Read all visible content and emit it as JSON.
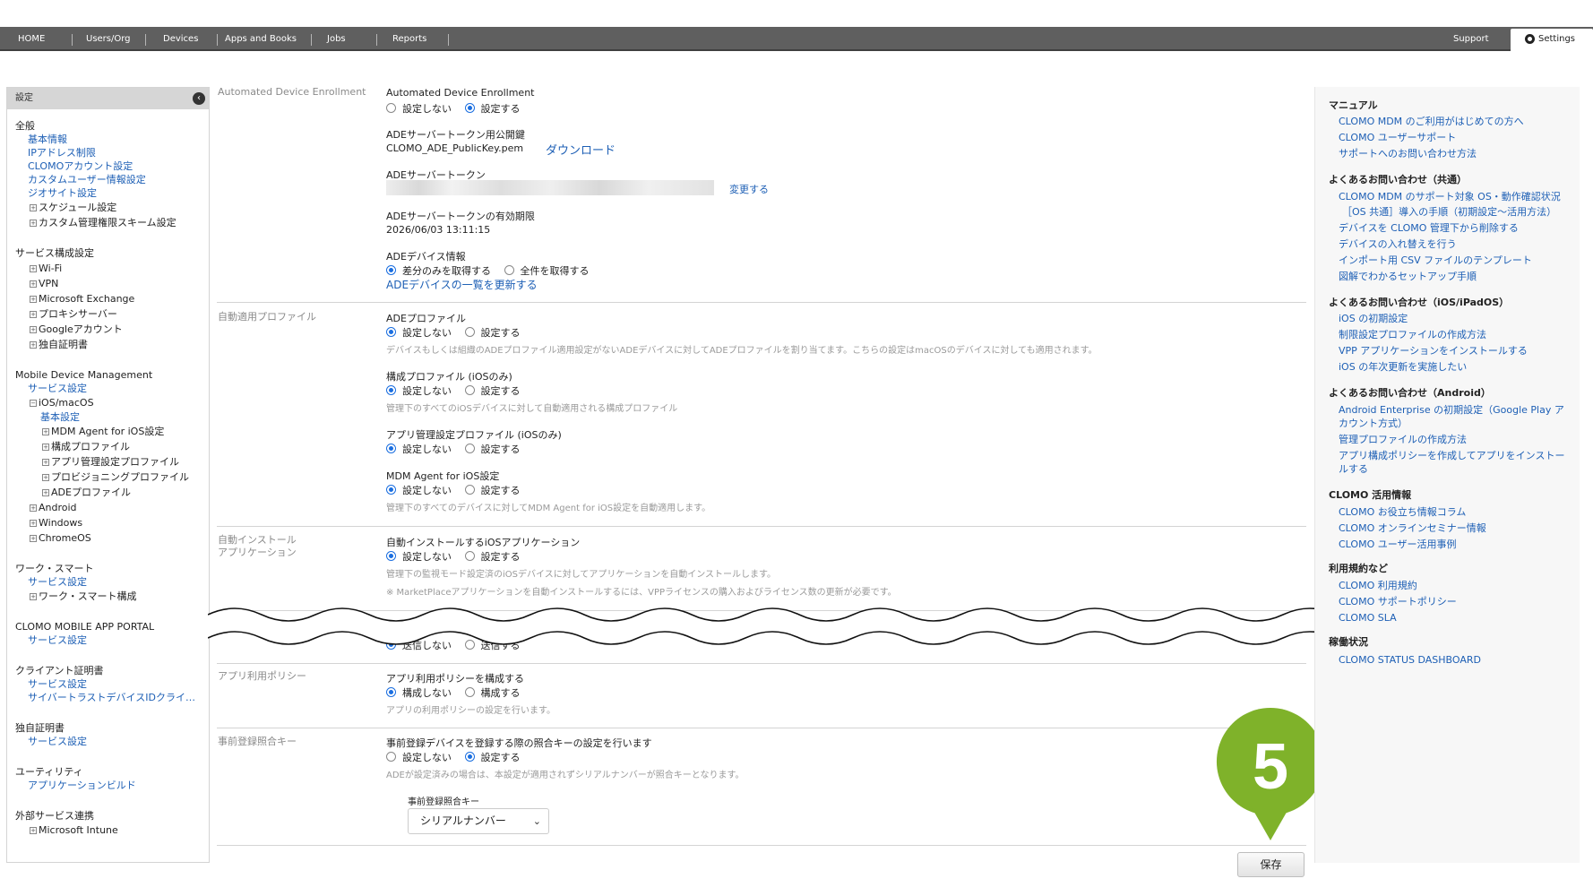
{
  "nav": {
    "home": "HOME",
    "users_org": "Users/Org",
    "devices": "Devices",
    "apps_books": "Apps and Books",
    "jobs": "Jobs",
    "reports": "Reports",
    "support": "Support",
    "settings": "Settings"
  },
  "sidebar": {
    "header": "設定",
    "general": {
      "title": "全般",
      "basic": "基本情報",
      "ip": "IPアドレス制限",
      "account": "CLOMOアカウント設定",
      "custom_user": "カスタムユーザー情報設定",
      "geo": "ジオサイト設定",
      "schedule": "スケジュール設定",
      "custom_scheme": "カスタム管理権限スキーム設定"
    },
    "service": {
      "title": "サービス構成設定",
      "wifi": "Wi-Fi",
      "vpn": "VPN",
      "exchange": "Microsoft Exchange",
      "proxy": "プロキシサーバー",
      "google": "Googleアカウント",
      "cert": "独自証明書"
    },
    "mdm": {
      "title": "Mobile Device Management",
      "service_settings": "サービス設定",
      "ios_macos": "iOS/macOS",
      "basic": "基本設定",
      "agent": "MDM Agent for iOS設定",
      "config_profile": "構成プロファイル",
      "app_profile": "アプリ管理設定プロファイル",
      "provisioning": "プロビジョニングプロファイル",
      "ade_profile": "ADEプロファイル",
      "android": "Android",
      "windows": "Windows",
      "chromeos": "ChromeOS"
    },
    "worksmart": {
      "title": "ワーク・スマート",
      "service_settings": "サービス設定",
      "config": "ワーク・スマート構成"
    },
    "portal": {
      "title": "CLOMO MOBILE APP PORTAL",
      "service_settings": "サービス設定"
    },
    "client_cert": {
      "title": "クライアント証明書",
      "service_settings": "サービス設定",
      "cybertrust": "サイバートラストデバイスIDクライ…"
    },
    "own_cert": {
      "title": "独自証明書",
      "service_settings": "サービス設定"
    },
    "utility": {
      "title": "ユーティリティ",
      "app_build": "アプリケーションビルド"
    },
    "external": {
      "title": "外部サービス連携",
      "intune": "Microsoft Intune"
    }
  },
  "main": {
    "ade": {
      "row_label": "Automated Device Enrollment",
      "title": "Automated Device Enrollment",
      "opt_off": "設定しない",
      "opt_on": "設定する",
      "selected": "設定する",
      "pubkey_label": "ADEサーバートークン用公開鍵",
      "pubkey_file": "CLOMO_ADE_PublicKey.pem",
      "download": "ダウンロード",
      "token_label": "ADEサーバートークン",
      "change": "変更する",
      "expiry_label": "ADEサーバートークンの有効期限",
      "expiry_value": "2026/06/03 13:11:15",
      "device_info_label": "ADEデバイス情報",
      "diff_only": "差分のみを取得する",
      "all": "全件を取得する",
      "update_list": "ADEデバイスの一覧を更新する"
    },
    "auto_profile": {
      "row_label": "自動適用プロファイル",
      "ade_title": "ADEプロファイル",
      "ade_help": "デバイスもしくは組織のADEプロファイル適用設定がないADEデバイスに対してADEプロファイルを割り当てます。こちらの設定はmacOSのデバイスに対しても適用されます。",
      "config_title": "構成プロファイル (iOSのみ)",
      "config_help": "管理下のすべてのiOSデバイスに対して自動適用される構成プロファイル",
      "app_title": "アプリ管理設定プロファイル (iOSのみ)",
      "agent_title": "MDM Agent for iOS設定",
      "agent_help": "管理下のすべてのデバイスに対してMDM Agent for iOS設定を自動適用します。",
      "opt_off": "設定しない",
      "opt_on": "設定する"
    },
    "auto_install": {
      "row_label_1": "自動インストール",
      "row_label_2": "アプリケーション",
      "title": "自動インストールするiOSアプリケーション",
      "opt_off": "設定しない",
      "opt_on": "設定する",
      "help1": "管理下の監視モード設定済のiOSデバイスに対してアプリケーションを自動インストールします。",
      "help2": "※ MarketPlaceアプリケーションを自動インストールするには、VPPライセンスの購入およびライセンス数の更新が必要です。"
    },
    "send": {
      "opt_off": "送信しない",
      "opt_on": "送信する"
    },
    "app_policy": {
      "row_label": "アプリ利用ポリシー",
      "title": "アプリ利用ポリシーを構成する",
      "opt_off": "構成しない",
      "opt_on": "構成する",
      "help": "アプリの利用ポリシーの設定を行います。"
    },
    "prereg": {
      "row_label": "事前登録照合キー",
      "title": "事前登録デバイスを登録する際の照合キーの設定を行います",
      "opt_off": "設定しない",
      "opt_on": "設定する",
      "help": "ADEが設定済みの場合は、本設定が適用されずシリアルナンバーが照合キーとなります。",
      "key_label": "事前登録照合キー",
      "key_value": "シリアルナンバー"
    },
    "save": "保存",
    "step_number": "5"
  },
  "right": {
    "manual": {
      "title": "マニュアル",
      "l1": "CLOMO MDM のご利用がはじめての方へ",
      "l2": "CLOMO ユーザーサポート",
      "l3": "サポートへのお問い合わせ方法"
    },
    "faq_common": {
      "title": "よくあるお問い合わせ（共通）",
      "l1": "CLOMO MDM のサポート対象 OS・動作確認状況",
      "l2": "［OS 共通］導入の手順（初期設定〜活用方法）",
      "l3": "デバイスを CLOMO 管理下から削除する",
      "l4": "デバイスの入れ替えを行う",
      "l5": "インポート用 CSV ファイルのテンプレート",
      "l6": "図解でわかるセットアップ手順"
    },
    "faq_ios": {
      "title": "よくあるお問い合わせ（iOS/iPadOS）",
      "l1": "iOS の初期設定",
      "l2": "制限設定プロファイルの作成方法",
      "l3": "VPP アプリケーションをインストールする",
      "l4": "iOS の年次更新を実施したい"
    },
    "faq_android": {
      "title": "よくあるお問い合わせ（Android）",
      "l1a": "Android Enterprise の初期設定（Google Play ア",
      "l1b": "カウント方式）",
      "l2": "管理プロファイルの作成方法",
      "l3a": "アプリ構成ポリシーを作成してアプリをインストー",
      "l3b": "ルする"
    },
    "usage": {
      "title": "CLOMO 活用情報",
      "l1": "CLOMO お役立ち情報コラム",
      "l2": "CLOMO オンラインセミナー情報",
      "l3": "CLOMO ユーザー活用事例"
    },
    "terms": {
      "title": "利用規約など",
      "l1": "CLOMO 利用規約",
      "l2": "CLOMO サポートポリシー",
      "l3": "CLOMO SLA"
    },
    "status": {
      "title": "稼働状況",
      "l1": "CLOMO STATUS DASHBOARD"
    }
  }
}
